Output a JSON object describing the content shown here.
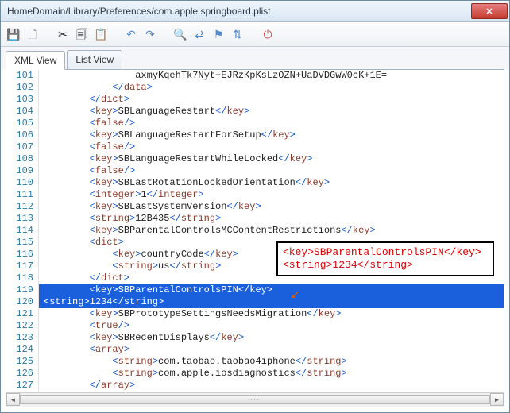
{
  "window": {
    "title": "HomeDomain/Library/Preferences/com.apple.springboard.plist"
  },
  "tabs": {
    "xml": "XML View",
    "list": "List View"
  },
  "callout": {
    "line1": "<key>SBParentalControlsPIN</key>",
    "line2": "<string>1234</string>"
  },
  "lines": [
    {
      "n": "101",
      "indent": 16,
      "plain": "axmyKqehTk7Nyt+EJRzKpKsLzOZN+UaDVDGwW0cK+1E="
    },
    {
      "n": "102",
      "indent": 12,
      "tag_close": "data"
    },
    {
      "n": "103",
      "indent": 8,
      "tag_close": "dict"
    },
    {
      "n": "104",
      "indent": 8,
      "key": "SBLanguageRestart"
    },
    {
      "n": "105",
      "indent": 8,
      "self": "false"
    },
    {
      "n": "106",
      "indent": 8,
      "key": "SBLanguageRestartForSetup"
    },
    {
      "n": "107",
      "indent": 8,
      "self": "false"
    },
    {
      "n": "108",
      "indent": 8,
      "key": "SBLanguageRestartWhileLocked"
    },
    {
      "n": "109",
      "indent": 8,
      "self": "false"
    },
    {
      "n": "110",
      "indent": 8,
      "key": "SBLastRotationLockedOrientation"
    },
    {
      "n": "111",
      "indent": 8,
      "wrap": "integer",
      "val": "1"
    },
    {
      "n": "112",
      "indent": 8,
      "key": "SBLastSystemVersion"
    },
    {
      "n": "113",
      "indent": 8,
      "wrap": "string",
      "val": "12B435"
    },
    {
      "n": "114",
      "indent": 8,
      "key": "SBParentalControlsMCContentRestrictions"
    },
    {
      "n": "115",
      "indent": 8,
      "tag_open": "dict"
    },
    {
      "n": "116",
      "indent": 12,
      "key": "countryCode"
    },
    {
      "n": "117",
      "indent": 12,
      "wrap": "string",
      "val": "us"
    },
    {
      "n": "118",
      "indent": 8,
      "tag_close": "dict"
    },
    {
      "n": "119",
      "indent": 8,
      "key": "SBParentalControlsPIN",
      "hl": true
    },
    {
      "n": "120",
      "indent": 0,
      "wrap": "string",
      "val": "1234",
      "hl": true
    },
    {
      "n": "121",
      "indent": 8,
      "key": "SBPrototypeSettingsNeedsMigration"
    },
    {
      "n": "122",
      "indent": 8,
      "self": "true"
    },
    {
      "n": "123",
      "indent": 8,
      "key": "SBRecentDisplays"
    },
    {
      "n": "124",
      "indent": 8,
      "tag_open": "array"
    },
    {
      "n": "125",
      "indent": 12,
      "wrap": "string",
      "val": "com.taobao.taobao4iphone"
    },
    {
      "n": "126",
      "indent": 12,
      "wrap": "string",
      "val": "com.apple.iosdiagnostics"
    },
    {
      "n": "127",
      "indent": 8,
      "tag_close": "array"
    }
  ]
}
